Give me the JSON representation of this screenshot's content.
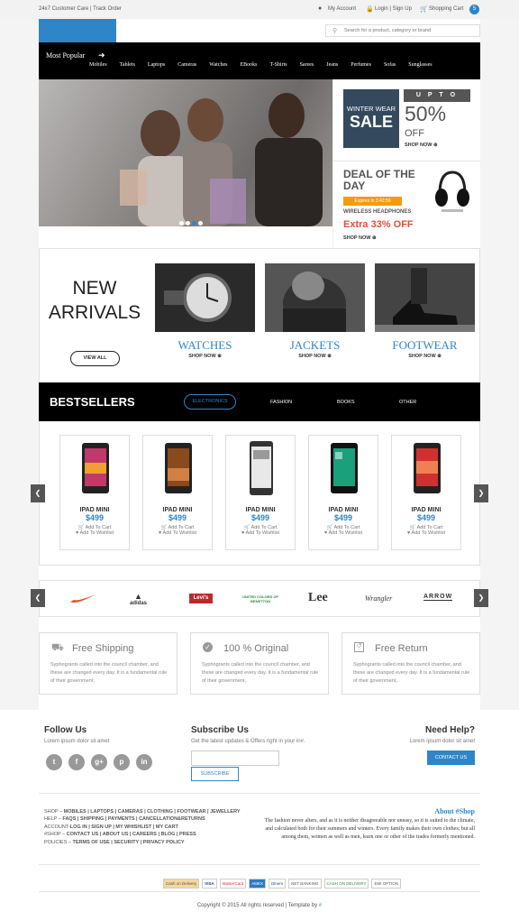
{
  "topbar": {
    "left": "24x7 Customer Care | Track Order",
    "account": "My Account",
    "login": "Login | Sign Up",
    "cart": "Shopping Cart",
    "cart_count": "5"
  },
  "search": {
    "placeholder": "Search for a product, category or brand"
  },
  "nav": {
    "most_popular": "Most Popular",
    "categories": [
      "Mobiles",
      "Tablets",
      "Laptops",
      "Cameras",
      "Watches",
      "EBooks",
      "T-Shirts",
      "Sarees",
      "Jeans",
      "Perfumes",
      "Sofas",
      "Sunglasses"
    ]
  },
  "promo": {
    "box_line1": "WINTER WEAR",
    "box_line2": "SALE",
    "upto": "U P T O",
    "percent": "50%",
    "off": "OFF",
    "shop_now": "SHOP NOW"
  },
  "deal": {
    "title_line1": "DEAL OF THE",
    "title_line2": "DAY",
    "expires": "Expires in 3:42:56",
    "product": "WIRELESS HEADPHONES",
    "offer": "Extra 33% OFF",
    "shop_now": "SHOP NOW"
  },
  "new_arrivals": {
    "line1": "NEW",
    "line2": "ARRIVALS",
    "view_all": "VIEW ALL",
    "items": [
      {
        "name": "WATCHES",
        "shop": "SHOP NOW"
      },
      {
        "name": "JACKETS",
        "shop": "SHOP NOW"
      },
      {
        "name": "FOOTWEAR",
        "shop": "SHOP NOW"
      }
    ]
  },
  "bestsellers": {
    "title": "BESTSELLERS",
    "tabs": [
      "ELECTRONICS",
      "FASHION",
      "BOOKS",
      "OTHER"
    ]
  },
  "products": [
    {
      "name": "IPAD MINI",
      "price": "$499",
      "cart": "Add To Cart",
      "wish": "Add To Wishlist"
    },
    {
      "name": "IPAD MINI",
      "price": "$499",
      "cart": "Add To Cart",
      "wish": "Add To Wishlist"
    },
    {
      "name": "IPAD MINI",
      "price": "$499",
      "cart": "Add To Cart",
      "wish": "Add To Wishlist"
    },
    {
      "name": "IPAD MINI",
      "price": "$499",
      "cart": "Add To Cart",
      "wish": "Add To Wishlist"
    },
    {
      "name": "IPAD MINI",
      "price": "$499",
      "cart": "Add To Cart",
      "wish": "Add To Wishlist"
    }
  ],
  "brands": [
    "adidas",
    "Levi's",
    "UNITED COLORS OF BENETTON",
    "Lee",
    "Wrangler",
    "ARROW"
  ],
  "features": [
    {
      "title": "Free Shipping",
      "text": "Syphogrants called into the council chamber, and these are changed every day. It is a fundamental rule of their government,"
    },
    {
      "title": "100 % Original",
      "text": "Syphogrants called into the council chamber, and these are changed every day. It is a fundamental rule of their government,"
    },
    {
      "title": "Free Return",
      "text": "Syphogrants called into the council chamber, and these are changed every day. It is a fundamental rule of their government,"
    }
  ],
  "footer": {
    "follow_title": "Follow Us",
    "follow_text": "Lorem ipsum dolor sit amet",
    "subscribe_title": "Subscribe Us",
    "subscribe_text": "Get the latest updates & Offers right in your in#.",
    "subscribe_btn": "SUBSCRIBE",
    "help_title": "Need Help?",
    "help_text": "Lorem ipsum dolor sit amet",
    "contact_btn": "CONTACT US",
    "link_rows": [
      {
        "label": "SHOP – ",
        "links": "MOBILES | LAPTOPS | CAMERAS | CLOTHING | FOOTWEAR | JEWELLERY"
      },
      {
        "label": "HELP – ",
        "links": "FAQS | SHIPPING | PAYMENTS | CANCELLATION&RETURNS"
      },
      {
        "label": "ACCOUNT-",
        "links": "LOG IN | SIGN UP | MY WHISHLIST | MY CART"
      },
      {
        "label": "#SHOP – ",
        "links": "CONTACT US | ABOUT US | CAREERS | BLOG | PRESS"
      },
      {
        "label": "POLICIES – ",
        "links": "TERMS OF USE | SECURITY | PRIVACY POLICY"
      }
    ],
    "about_title": "About #Shop",
    "about_text": "The fashion never alters, and as it is neither disagreeable nor uneasy, so it is suited to the climate, and calculated both for their summers and winters. Every family makes their own clothes; but all among them, women as well as men, learn one or other of the trades formerly mentioned.",
    "payments": [
      "Cash on Delivery",
      "VISA",
      "MasterCard",
      "AMEX",
      "Diners",
      "NET BANKING",
      "CASH ON DELIVERY",
      "EMI OPTION"
    ],
    "copyright": "Copyright © 2015 All rights reserved | Template by",
    "copyright_link": "#"
  },
  "colors": {
    "accent": "#2e86c8",
    "nav": "#000000",
    "price": "#2e86c8",
    "offer": "#e74c3c",
    "expires": "#f39c12"
  }
}
